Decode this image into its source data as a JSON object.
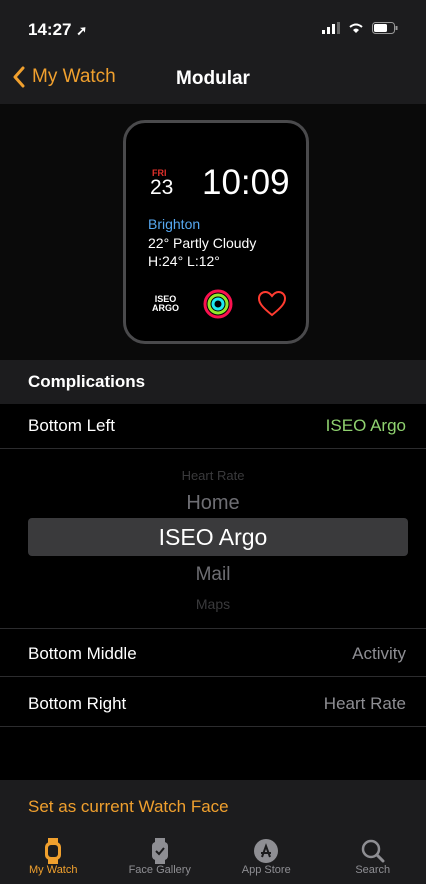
{
  "status": {
    "time": "14:27"
  },
  "nav": {
    "back_label": "My Watch",
    "title": "Modular"
  },
  "watch_face": {
    "day": "FRI",
    "date": "23",
    "time": "10:09",
    "city": "Brighton",
    "weather": "22° Partly Cloudy",
    "hilo": "H:24° L:12°",
    "iseo_top": "ISEO",
    "iseo_bottom": "ARGO"
  },
  "complications": {
    "header": "Complications",
    "bottom_left": {
      "label": "Bottom Left",
      "value": "ISEO Argo"
    },
    "bottom_middle": {
      "label": "Bottom Middle",
      "value": "Activity"
    },
    "bottom_right": {
      "label": "Bottom Right",
      "value": "Heart Rate"
    }
  },
  "picker": [
    "Heart Rate",
    "Home",
    "ISEO Argo",
    "Mail",
    "Maps"
  ],
  "cta": "Set as current Watch Face",
  "tabs": [
    {
      "label": "My Watch"
    },
    {
      "label": "Face Gallery"
    },
    {
      "label": "App Store"
    },
    {
      "label": "Search"
    }
  ],
  "colors": {
    "accent": "#f0a02e",
    "value_green": "#8fd16f",
    "city_blue": "#57a8f0"
  }
}
